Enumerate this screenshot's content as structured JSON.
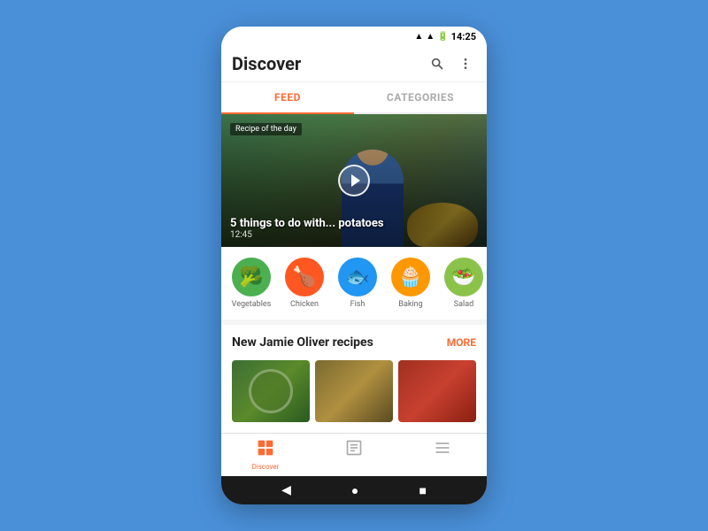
{
  "statusBar": {
    "time": "14:25"
  },
  "appBar": {
    "title": "Discover",
    "searchLabel": "search",
    "moreLabel": "more"
  },
  "tabs": [
    {
      "id": "feed",
      "label": "FEED",
      "active": true
    },
    {
      "id": "categories",
      "label": "CATEGORIES",
      "active": false
    }
  ],
  "hero": {
    "badge": "Recipe of the day",
    "title": "5 things to do with... potatoes",
    "duration": "12:45"
  },
  "categories": [
    {
      "id": "vegetables",
      "label": "Vegetables",
      "color": "#4CAF50",
      "icon": "🥦"
    },
    {
      "id": "chicken",
      "label": "Chicken",
      "color": "#FF5722",
      "icon": "🍗"
    },
    {
      "id": "fish",
      "label": "Fish",
      "color": "#2196F3",
      "icon": "🐟"
    },
    {
      "id": "baking",
      "label": "Baking",
      "color": "#FF9800",
      "icon": "🧁"
    },
    {
      "id": "salad",
      "label": "Salad",
      "color": "#8BC34A",
      "icon": "🥗"
    }
  ],
  "recipesSection": {
    "title": "New Jamie Oliver recipes",
    "moreLabel": "MORE"
  },
  "bottomNav": [
    {
      "id": "discover",
      "label": "Discover",
      "icon": "⊞",
      "active": true
    },
    {
      "id": "recipes",
      "label": "Recipes",
      "icon": "📖",
      "active": false
    },
    {
      "id": "menu",
      "label": "Menu",
      "icon": "☰",
      "active": false
    }
  ],
  "androidNav": {
    "back": "◀",
    "home": "●",
    "recent": "■"
  }
}
